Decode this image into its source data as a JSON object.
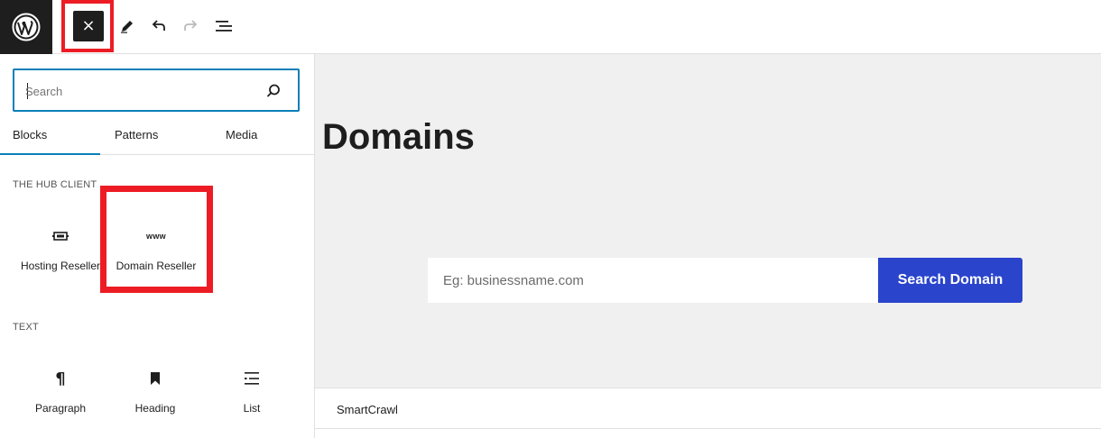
{
  "toolbar": {
    "logo_icon": "wordpress-logo-icon",
    "close_icon": "close-icon",
    "tools_icon": "pencil-icon",
    "undo_icon": "undo-icon",
    "redo_icon": "redo-icon",
    "list_view_icon": "list-view-icon",
    "close_glyph": "×"
  },
  "inserter": {
    "search": {
      "placeholder": "Search",
      "value": ""
    },
    "tabs": [
      {
        "label": "Blocks",
        "active": true
      },
      {
        "label": "Patterns",
        "active": false
      },
      {
        "label": "Media",
        "active": false
      }
    ],
    "categories": [
      {
        "title": "THE HUB CLIENT",
        "blocks": [
          {
            "label": "Hosting Reseller",
            "icon": "server-icon"
          },
          {
            "label": "Domain Reseller",
            "icon": "www-icon",
            "icon_text": "www"
          }
        ]
      },
      {
        "title": "TEXT",
        "blocks": [
          {
            "label": "Paragraph",
            "icon": "paragraph-icon",
            "icon_text": "¶"
          },
          {
            "label": "Heading",
            "icon": "bookmark-icon"
          },
          {
            "label": "List",
            "icon": "list-icon"
          }
        ]
      }
    ]
  },
  "canvas": {
    "title": "Domains",
    "domain_search": {
      "placeholder": "Eg: businessname.com",
      "button_label": "Search Domain"
    }
  },
  "bottom_panel": {
    "label": "SmartCrawl"
  },
  "colors": {
    "highlight": "#ed1c24",
    "accent": "#0a7fb8",
    "button": "#2a44cc",
    "dark": "#1e1e1e"
  }
}
